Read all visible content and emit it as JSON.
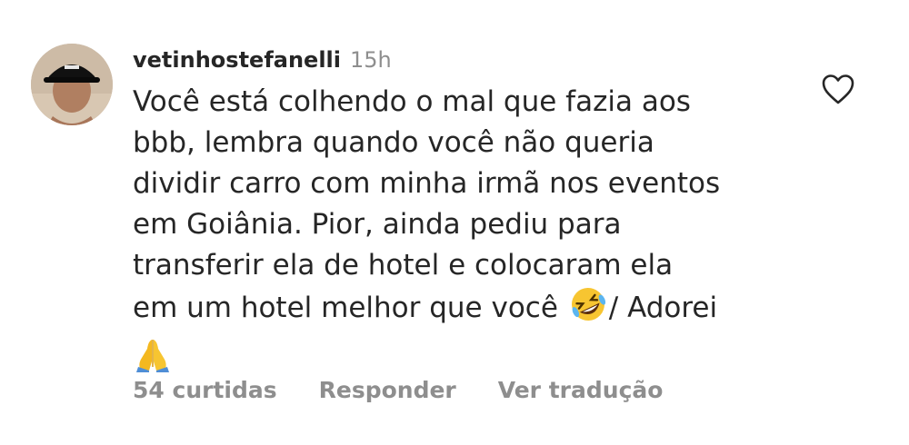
{
  "comment": {
    "username": "vetinhostefanelli",
    "time": "15h",
    "text_lines": [
      "Você está colhendo o mal que fazia aos",
      "bbb, lembra quando você não queria",
      "dividir carro com minha irmã nos eventos",
      "em Goiânia. Pior, ainda pediu para",
      "transferir ela de hotel e colocaram ela",
      "em um hotel melhor que você "
    ],
    "text_after_emoji": "/ Adorei",
    "emoji_1": "rolling-on-floor-laughing-emoji",
    "emoji_2": "folded-hands-emoji",
    "likes": "54 curtidas",
    "reply": "Responder",
    "translate": "Ver tradução"
  },
  "icons": {
    "like": "heart-icon"
  },
  "colors": {
    "text": "#262626",
    "muted": "#8e8e8e"
  }
}
